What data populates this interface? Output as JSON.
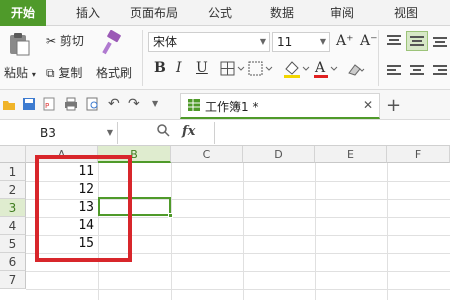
{
  "tabs": [
    "开始",
    "插入",
    "页面布局",
    "公式",
    "数据",
    "审阅",
    "视图"
  ],
  "ribbon": {
    "paste_label": "粘贴",
    "cut_label": "剪切",
    "copy_label": "复制",
    "format_painter_label": "格式刷",
    "font_name": "宋体",
    "font_size": "11",
    "bold": "B",
    "italic": "I",
    "underline": "U",
    "grow_font": "A⁺",
    "shrink_font": "A⁻"
  },
  "doc_tab": {
    "title": "工作簿1 *",
    "close": "✕",
    "new_tab": "+"
  },
  "formula_bar": {
    "cell_ref": "B3",
    "fx_label": "fx",
    "value": ""
  },
  "columns": [
    "A",
    "B",
    "C",
    "D",
    "E",
    "F"
  ],
  "rows": [
    "1",
    "2",
    "3",
    "4",
    "5",
    "6",
    "7"
  ],
  "cells_A": [
    "11",
    "12",
    "13",
    "14",
    "15"
  ],
  "colors": {
    "accent": "#4f9a2a",
    "highlight": "#d8262b"
  }
}
